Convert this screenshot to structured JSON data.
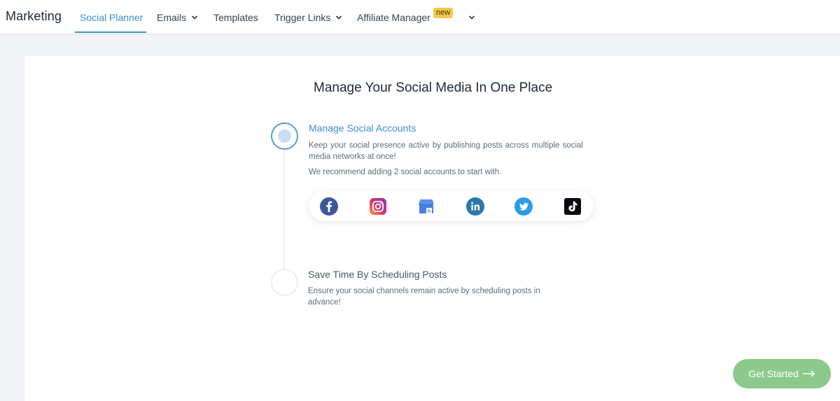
{
  "header": {
    "brand": "Marketing",
    "tabs": [
      {
        "label": "Social Planner"
      },
      {
        "label": "Emails"
      },
      {
        "label": "Templates"
      },
      {
        "label": "Trigger Links"
      },
      {
        "label": "Affiliate Manager"
      }
    ],
    "badge": "new"
  },
  "main": {
    "headline": "Manage Your Social Media In One Place",
    "steps": [
      {
        "title": "Manage Social Accounts",
        "description": "Keep your social presence active by publishing posts across multiple social media networks at once!",
        "recommendation": "We recommend adding 2 social accounts to start with."
      },
      {
        "title": "Save Time By Scheduling Posts",
        "description": "Ensure your social channels remain active by scheduling posts in advance!"
      }
    ],
    "social_networks": [
      "facebook-icon",
      "instagram-icon",
      "google-business-icon",
      "linkedin-icon",
      "twitter-icon",
      "tiktok-icon"
    ],
    "cta": "Get Started"
  },
  "colors": {
    "accent": "#3b8ed0",
    "cta": "#8bc98c",
    "badge": "#f3c94c"
  }
}
